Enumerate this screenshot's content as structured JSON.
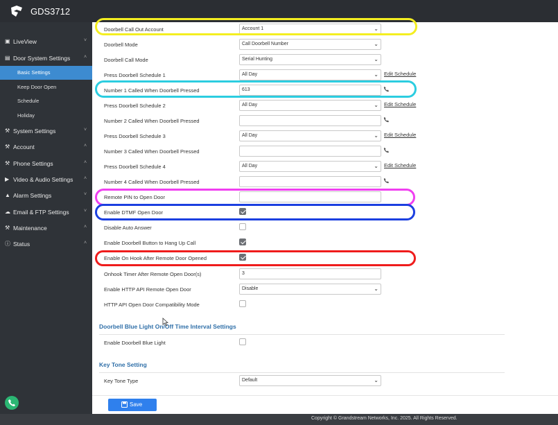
{
  "app": {
    "title": "GDS3712"
  },
  "sidebar": {
    "items": [
      {
        "label": "LiveView",
        "icon": "liveview-icon",
        "chevron": "˅"
      },
      {
        "label": "Door System Settings",
        "icon": "door-icon",
        "chevron": "˄"
      },
      {
        "label": "System Settings",
        "icon": "settings-icon",
        "chevron": "˅"
      },
      {
        "label": "Account",
        "icon": "account-icon",
        "chevron": "˄"
      },
      {
        "label": "Phone Settings",
        "icon": "phone-settings-icon",
        "chevron": "˄"
      },
      {
        "label": "Video & Audio Settings",
        "icon": "video-audio-icon",
        "chevron": "˄"
      },
      {
        "label": "Alarm Settings",
        "icon": "alarm-icon",
        "chevron": "˅"
      },
      {
        "label": "Email & FTP Settings",
        "icon": "email-icon",
        "chevron": "˅"
      },
      {
        "label": "Maintenance",
        "icon": "maintenance-icon",
        "chevron": "˄"
      },
      {
        "label": "Status",
        "icon": "status-icon",
        "chevron": "˄"
      }
    ],
    "subitems": [
      {
        "label": "Basic Settings",
        "active": true
      },
      {
        "label": "Keep Door Open",
        "active": false
      },
      {
        "label": "Schedule",
        "active": false
      },
      {
        "label": "Holiday",
        "active": false
      }
    ]
  },
  "form": {
    "rows": [
      {
        "label": "Doorbell Call Out Account",
        "type": "select",
        "value": "Account 1"
      },
      {
        "label": "Doorbell Mode",
        "type": "select",
        "value": "Call Doorbell Number"
      },
      {
        "label": "Doorbell Call Mode",
        "type": "select",
        "value": "Serial Hunting"
      },
      {
        "label": "Press Doorbell Schedule 1",
        "type": "select",
        "value": "All Day",
        "edit": "Edit Schedule"
      },
      {
        "label": "Number 1 Called When Doorbell Pressed",
        "type": "input",
        "value": "613"
      },
      {
        "label": "Press Doorbell Schedule 2",
        "type": "select",
        "value": "All Day",
        "edit": "Edit Schedule"
      },
      {
        "label": "Number 2 Called When Doorbell Pressed",
        "type": "input",
        "value": ""
      },
      {
        "label": "Press Doorbell Schedule 3",
        "type": "select",
        "value": "All Day",
        "edit": "Edit Schedule"
      },
      {
        "label": "Number 3 Called When Doorbell Pressed",
        "type": "input",
        "value": ""
      },
      {
        "label": "Press Doorbell Schedule 4",
        "type": "select",
        "value": "All Day",
        "edit": "Edit Schedule"
      },
      {
        "label": "Number 4 Called When Doorbell Pressed",
        "type": "input",
        "value": ""
      },
      {
        "label": "Remote PIN to Open Door",
        "type": "input",
        "value": ""
      },
      {
        "label": "Enable DTMF Open Door",
        "type": "checkbox",
        "checked": true
      },
      {
        "label": "Disable Auto Answer",
        "type": "checkbox",
        "checked": false
      },
      {
        "label": "Enable Doorbell Button to Hang Up Call",
        "type": "checkbox",
        "checked": true
      },
      {
        "label": "Enable On Hook After Remote Door Opened",
        "type": "checkbox",
        "checked": true
      },
      {
        "label": "Onhook Timer After Remote Open Door(s)",
        "type": "input",
        "value": "3"
      },
      {
        "label": "Enable HTTP API Remote Open Door",
        "type": "select",
        "value": "Disable"
      },
      {
        "label": "HTTP API Open Door Compatibility Mode",
        "type": "checkbox",
        "checked": false
      }
    ],
    "sections": [
      {
        "title": "Doorbell Blue Light On/Off Time Interval Settings"
      },
      {
        "title": "Key Tone Setting"
      }
    ],
    "blue_light": {
      "label": "Enable Doorbell Blue Light",
      "checked": false
    },
    "key_tone": {
      "label": "Key Tone Type",
      "value": "Default"
    }
  },
  "highlights": {
    "colors": [
      "#f4ee20",
      "#2ccde0",
      "#f03ff0",
      "#1b3fe0",
      "#ef1c1c"
    ]
  },
  "save": {
    "label": "Save"
  },
  "footer": {
    "copyright": "Copyright © Grandstream Networks, Inc. 2025. All Rights Reserved."
  }
}
